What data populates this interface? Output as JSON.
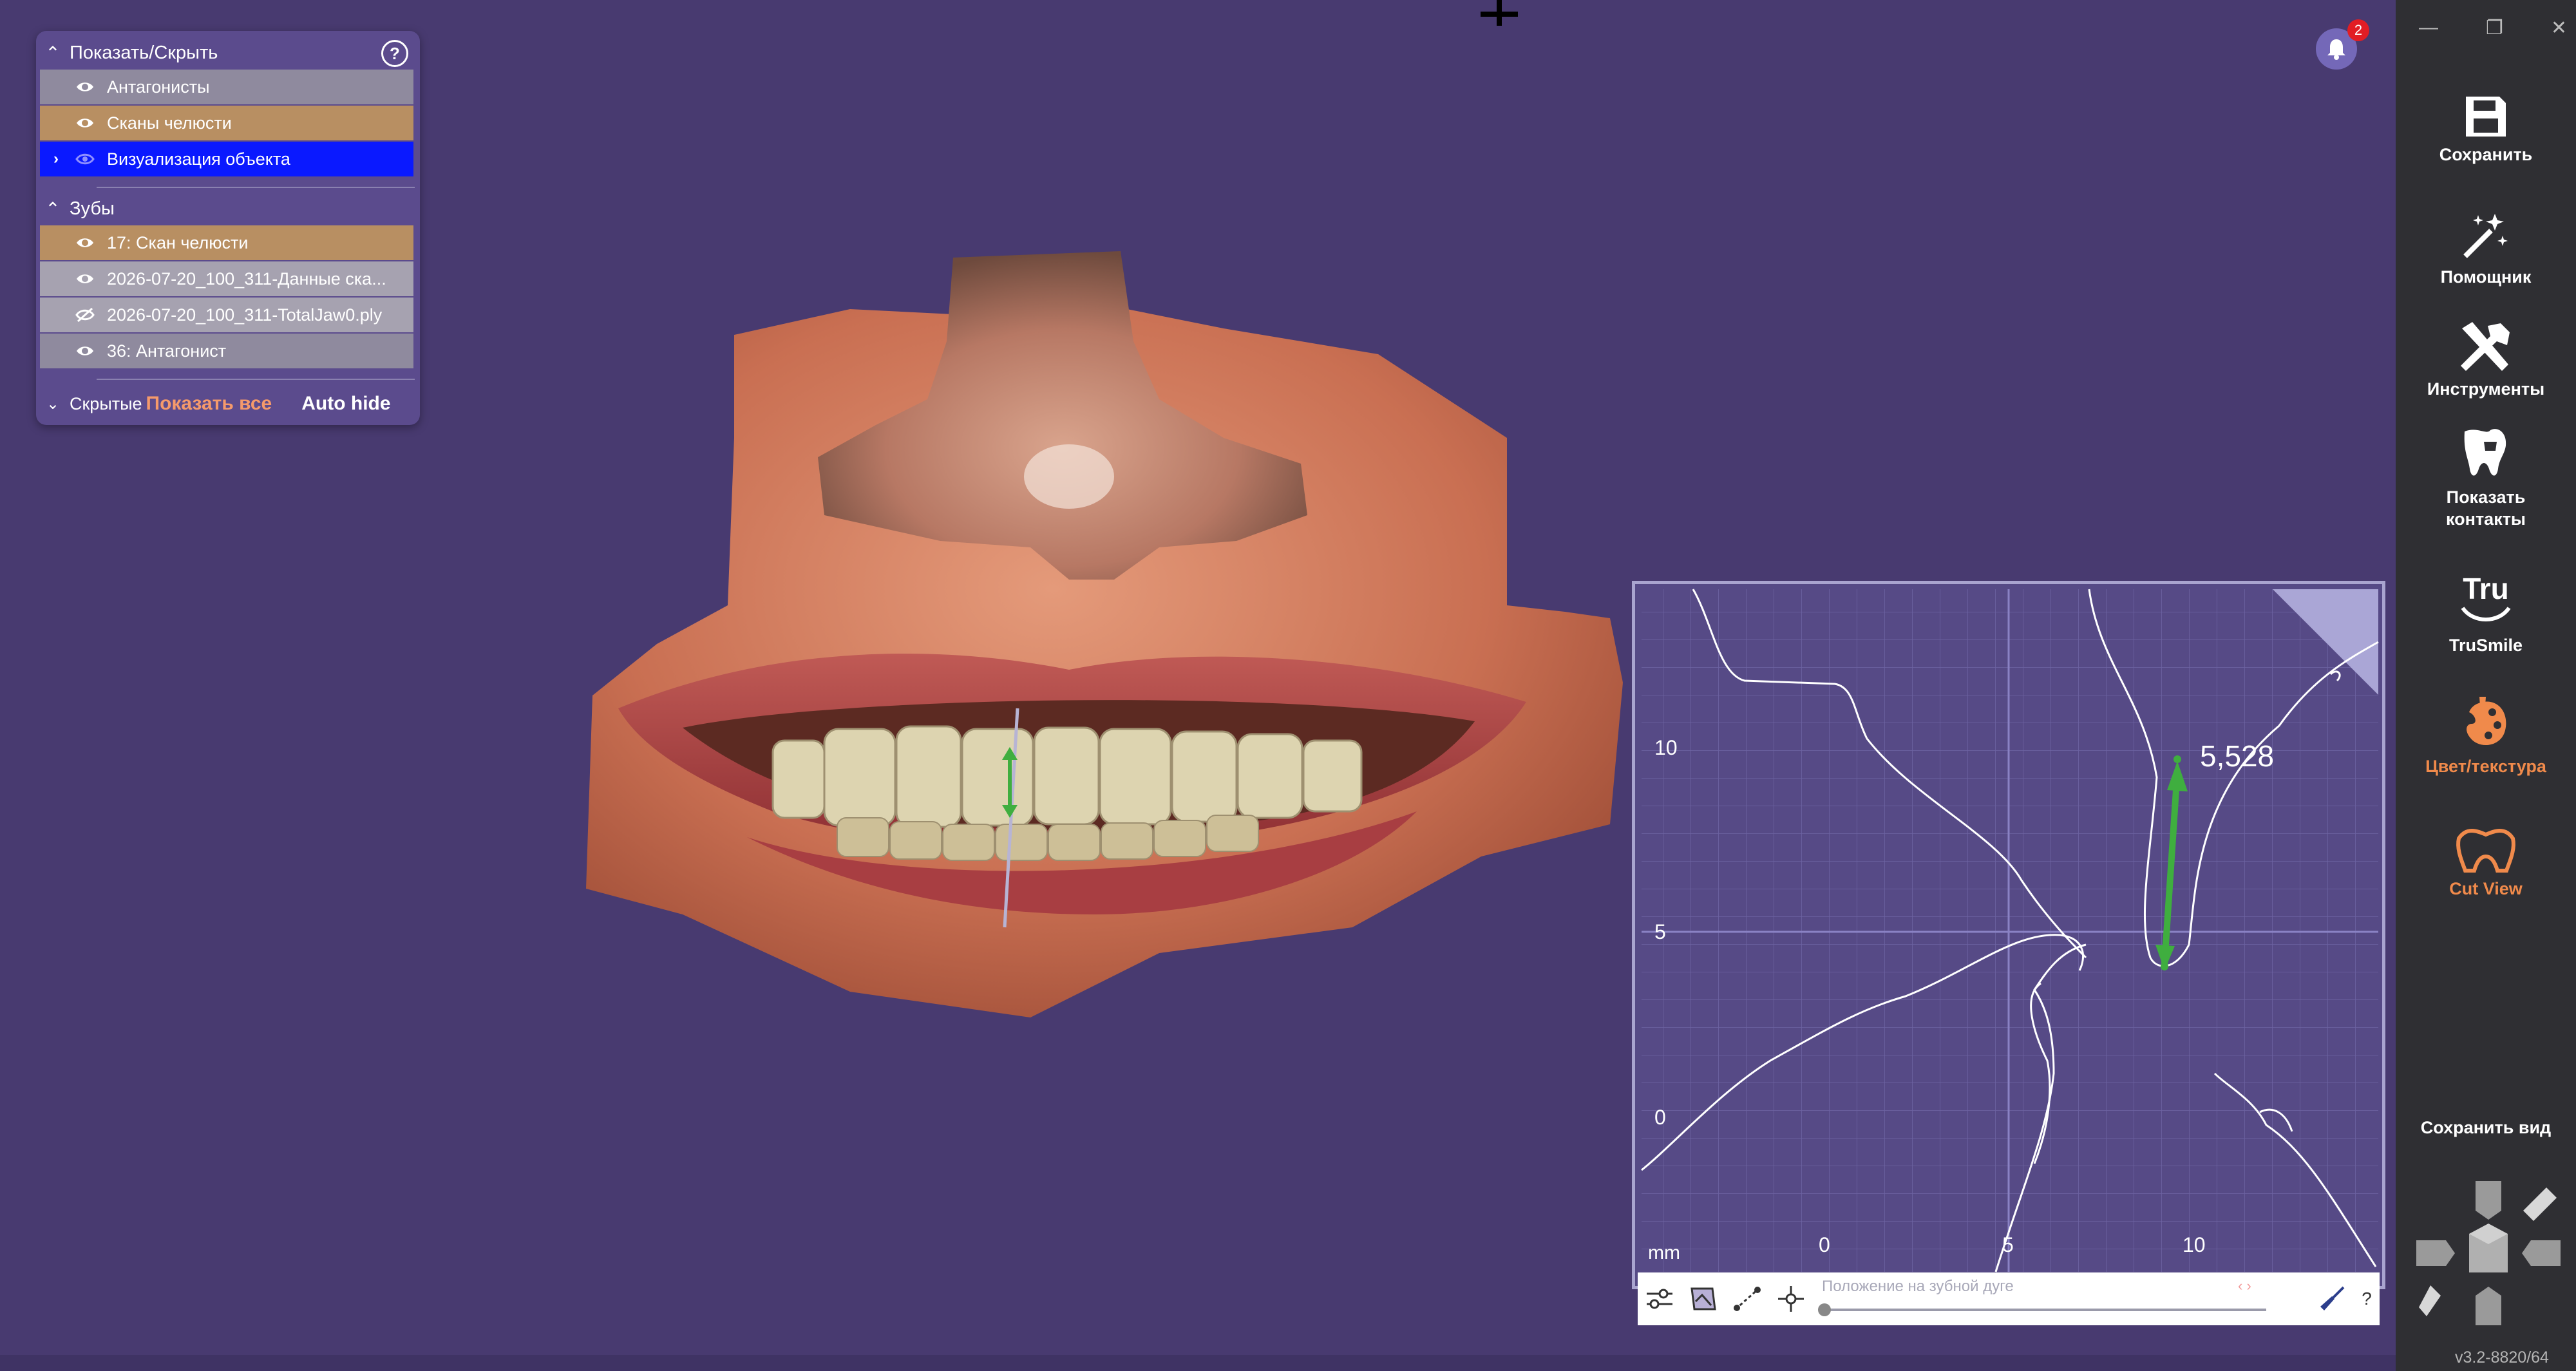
{
  "left_panel": {
    "section_show_hide": "Показать/Скрыть",
    "help_glyph": "?",
    "items_top": [
      {
        "label": "Антагонисты",
        "color": "#8f8a9e",
        "visible": true
      },
      {
        "label": "Сканы челюсти",
        "color": "#b88f62",
        "visible": true
      },
      {
        "label": "Визуализация объекта",
        "color": "#0a19ff",
        "visible": true,
        "expandable": true
      }
    ],
    "section_teeth": "Зубы",
    "items_teeth": [
      {
        "label": "17: Скан челюсти",
        "color": "#b88f62",
        "visible": true
      },
      {
        "label": "2026-07-20_100_311-Данные ска...",
        "color": "#a6a2b0",
        "visible": true
      },
      {
        "label": "2026-07-20_100_311-TotalJaw0.ply",
        "color": "#a6a2b0",
        "visible": false
      },
      {
        "label": "36: Антагонист",
        "color": "#8f8a9e",
        "visible": true
      }
    ],
    "hidden_label": "Скрытые",
    "show_all": "Показать все",
    "auto_hide": "Auto hide"
  },
  "notifications": {
    "count": "2"
  },
  "cut_view": {
    "measurement": "5,528",
    "unit": "mm",
    "y_ticks": [
      "10",
      "5",
      "0"
    ],
    "x_ticks": [
      "0",
      "5",
      "10"
    ],
    "slider_label": "Положение на зубной дуге",
    "help": "?"
  },
  "sidebar": {
    "window_buttons": [
      "—",
      "❐",
      "✕"
    ],
    "items": [
      {
        "label": "Сохранить",
        "icon": "floppy-icon"
      },
      {
        "label": "Помощник",
        "icon": "magic-wand-icon"
      },
      {
        "label": "Инструменты",
        "icon": "tools-icon"
      },
      {
        "label": "Показать контакты",
        "icon": "tooth-contacts-icon"
      },
      {
        "label": "TruSmile",
        "icon": "trusmile-icon"
      },
      {
        "label": "Цвет/текстура",
        "icon": "palette-icon"
      },
      {
        "label": "Cut View",
        "icon": "cut-view-icon"
      }
    ],
    "save_view": "Сохранить вид",
    "version": "v3.2-8820/64"
  },
  "colors": {
    "viewport_bg": "#483a70",
    "sidebar_bg": "#2f2f33",
    "accent_orange": "#f08a4b",
    "measure_green": "#3fae3f"
  }
}
